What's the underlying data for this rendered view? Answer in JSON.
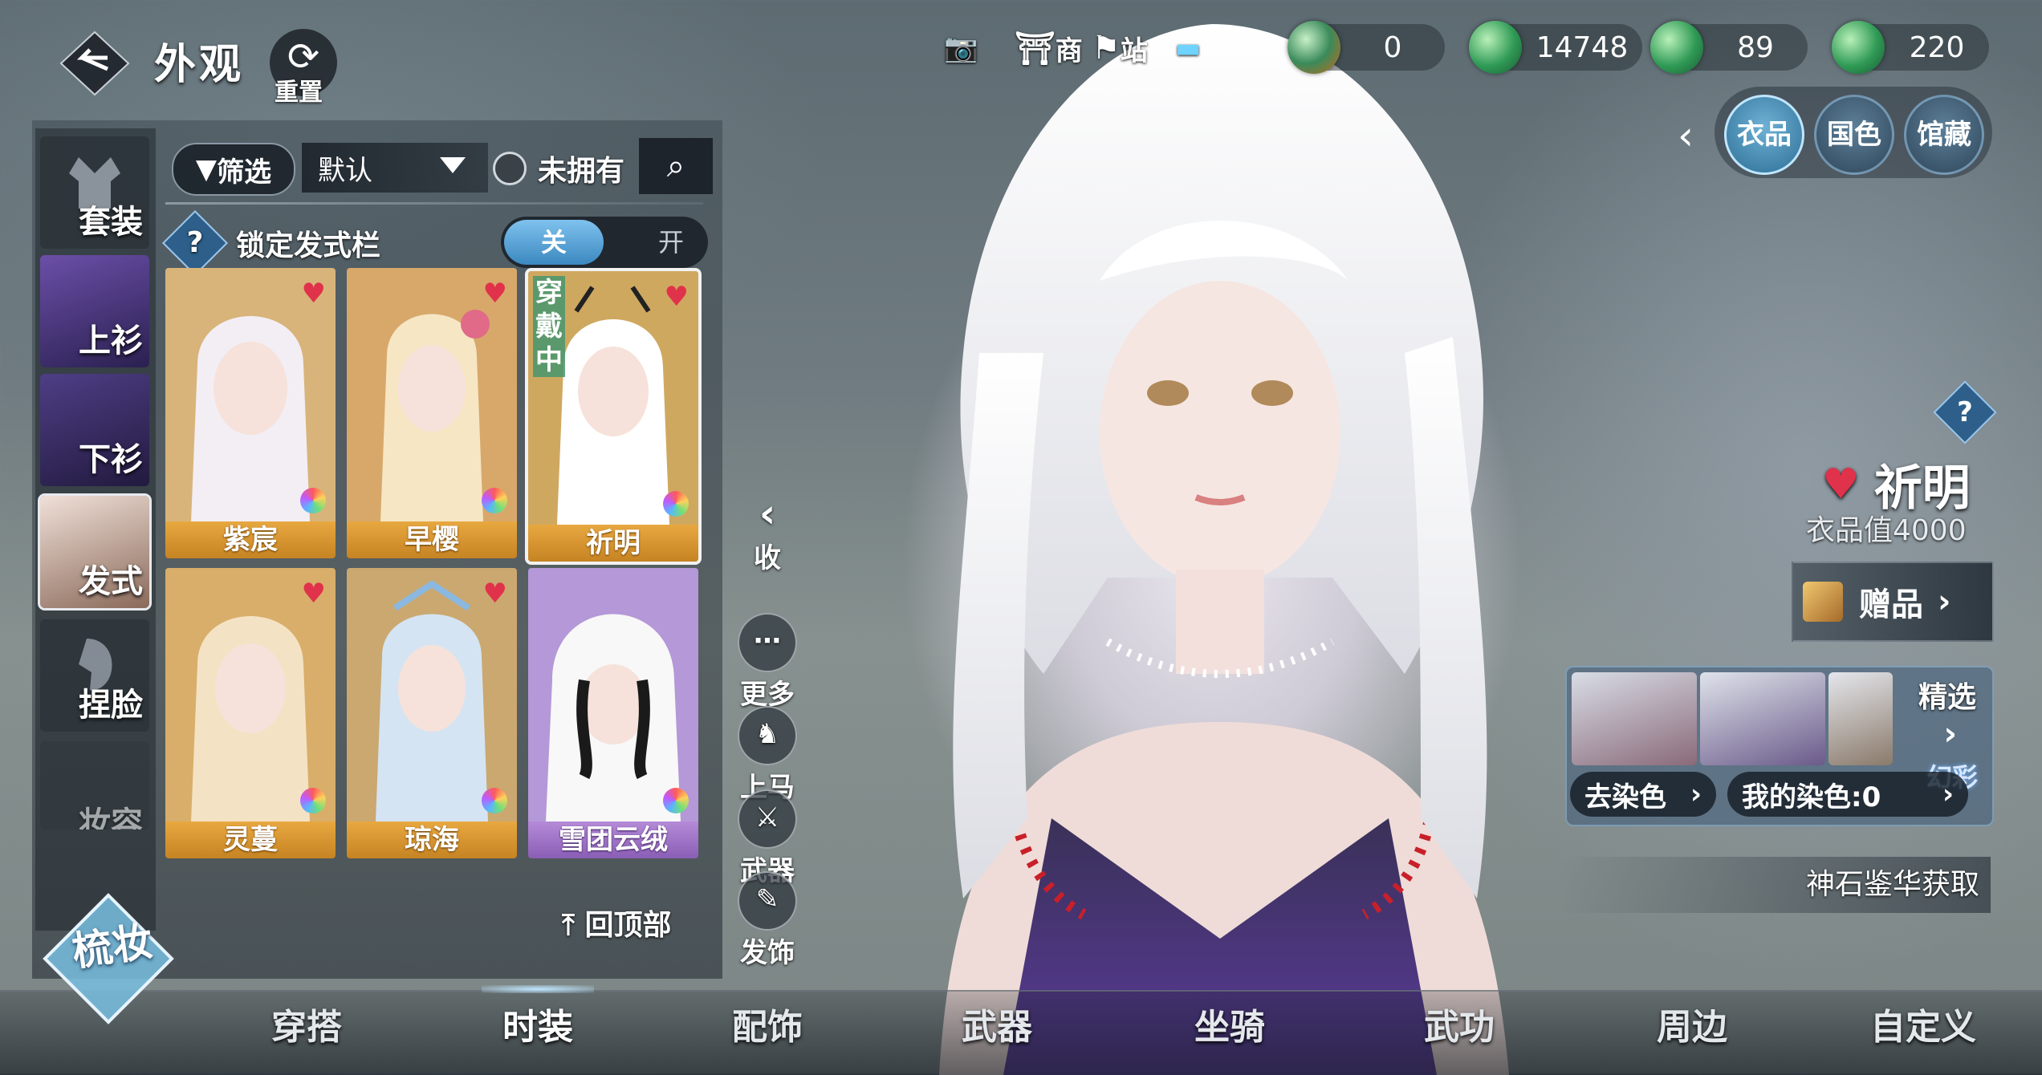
{
  "header": {
    "title": "外观",
    "reset_label": "重置"
  },
  "top_icons": [
    {
      "name": "camera-icon",
      "label": ""
    },
    {
      "name": "shop-icon",
      "label": "商"
    },
    {
      "name": "station-icon",
      "label": "站"
    }
  ],
  "currencies": [
    {
      "name": "jade-currency",
      "value": "0"
    },
    {
      "name": "coin-currency-1",
      "value": "14748"
    },
    {
      "name": "coin-currency-2",
      "value": "89"
    },
    {
      "name": "coin-currency-3",
      "value": "220"
    }
  ],
  "right_tabs": [
    {
      "label": "衣品",
      "active": true
    },
    {
      "label": "国色",
      "active": false
    },
    {
      "label": "馆藏",
      "active": false
    }
  ],
  "categories": [
    {
      "label": "套装"
    },
    {
      "label": "上衫"
    },
    {
      "label": "下衫"
    },
    {
      "label": "发式",
      "selected": true
    },
    {
      "label": "捏脸"
    },
    {
      "label": "妆容"
    }
  ],
  "filters": {
    "filter_label": "筛选",
    "sort_value": "默认",
    "owned_label": "未拥有"
  },
  "lock_row": {
    "label": "锁定发式栏",
    "on_label": "关",
    "off_label": "开"
  },
  "hairstyles": [
    {
      "name": "紫宸",
      "wearing": false,
      "color": "gold"
    },
    {
      "name": "早樱",
      "wearing": false,
      "color": "gold"
    },
    {
      "name": "祈明",
      "wearing": true,
      "wearing_label": "穿戴中",
      "color": "gold"
    },
    {
      "name": "灵蔓",
      "wearing": false,
      "color": "gold"
    },
    {
      "name": "琼海",
      "wearing": false,
      "color": "gold"
    },
    {
      "name": "雪团云绒",
      "wearing": false,
      "color": "purple"
    }
  ],
  "back_to_top": "回顶部",
  "actions": {
    "collapse": "收",
    "more": "更多",
    "mount": "上马",
    "weapon": "武器",
    "hair_accessory": "发饰"
  },
  "item_info": {
    "name": "祈明",
    "value_text": "衣品值4000",
    "gift_label": "赠品"
  },
  "dye": {
    "featured_label": "精选",
    "effect_label": "幻彩",
    "go_dye_label": "去染色",
    "my_dye_label": "我的染色:0"
  },
  "source_text": "神石鉴华获取",
  "bottom_nav": [
    {
      "label": "穿搭",
      "active": false
    },
    {
      "label": "时装",
      "active": true
    },
    {
      "label": "配饰",
      "active": false
    },
    {
      "label": "武器",
      "active": false
    },
    {
      "label": "坐骑",
      "active": false
    },
    {
      "label": "武功",
      "active": false
    },
    {
      "label": "周边",
      "active": false
    },
    {
      "label": "自定义",
      "active": false
    }
  ],
  "corner_badge": "梳妆",
  "colors": {
    "accent": "#3b88c0",
    "gold": "#d6962e",
    "purple": "#9a6ec6",
    "heart": "#e0324a"
  }
}
